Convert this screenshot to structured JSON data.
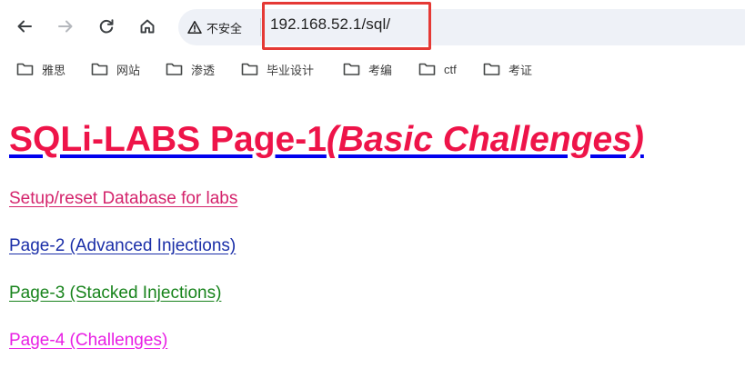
{
  "browser": {
    "security_label": "不安全",
    "url": "192.168.52.1/sql/"
  },
  "bookmarks": [
    {
      "label": "雅思"
    },
    {
      "label": "网站"
    },
    {
      "label": "渗透"
    },
    {
      "label": "毕业设计"
    },
    {
      "label": "考编"
    },
    {
      "label": "ctf"
    },
    {
      "label": "考证"
    }
  ],
  "page": {
    "title_main": "SQLi-LABS Page-1",
    "title_sub": "(Basic Challenges)",
    "links": [
      {
        "label": "Setup/reset Database for labs",
        "color": "#d4246c"
      },
      {
        "label": "Page-2 (Advanced Injections)",
        "color": "#1a2ea8"
      },
      {
        "label": "Page-3 (Stacked Injections)",
        "color": "#17831b"
      },
      {
        "label": "Page-4 (Challenges)",
        "color": "#e81fe4"
      }
    ],
    "title_color": "#ee1449",
    "underline_color": "#0000ee"
  },
  "colors": {
    "highlight_box": "#e53935",
    "omnibox_bg": "#eef1f7"
  }
}
